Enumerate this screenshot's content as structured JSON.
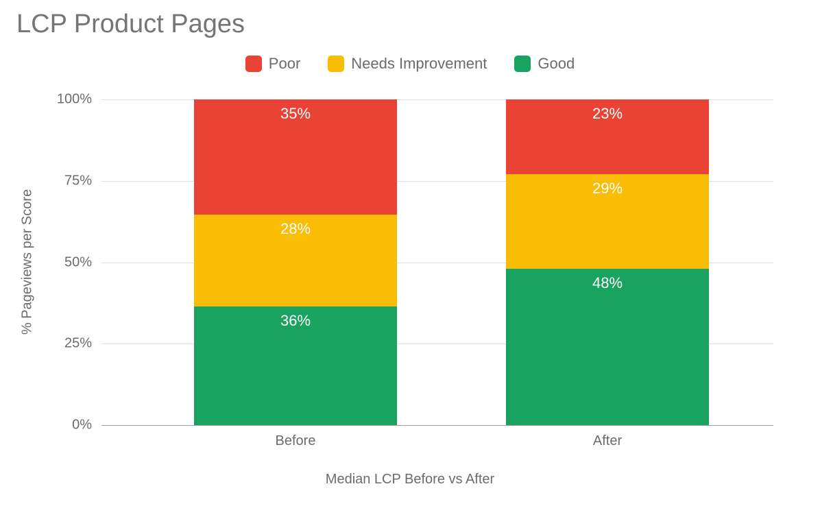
{
  "chart_data": {
    "type": "bar",
    "stacked": true,
    "title": "LCP Product Pages",
    "xlabel": "Median LCP Before vs After",
    "ylabel": "% Pageviews per Score",
    "ylim": [
      0,
      100
    ],
    "yticks": [
      0,
      25,
      50,
      75,
      100
    ],
    "ytick_labels": [
      "0%",
      "25%",
      "50%",
      "75%",
      "100%"
    ],
    "categories": [
      "Before",
      "After"
    ],
    "series": [
      {
        "name": "Good",
        "color": "#1aa260",
        "values": [
          36,
          48
        ]
      },
      {
        "name": "Needs Improvement",
        "color": "#f9bd06",
        "values": [
          28,
          29
        ]
      },
      {
        "name": "Poor",
        "color": "#ea4335",
        "values": [
          35,
          23
        ]
      }
    ],
    "legend_order": [
      "Poor",
      "Needs Improvement",
      "Good"
    ],
    "data_labels": {
      "Before": {
        "Good": "36%",
        "Needs Improvement": "28%",
        "Poor": "35%"
      },
      "After": {
        "Good": "48%",
        "Needs Improvement": "29%",
        "Poor": "23%"
      }
    }
  }
}
